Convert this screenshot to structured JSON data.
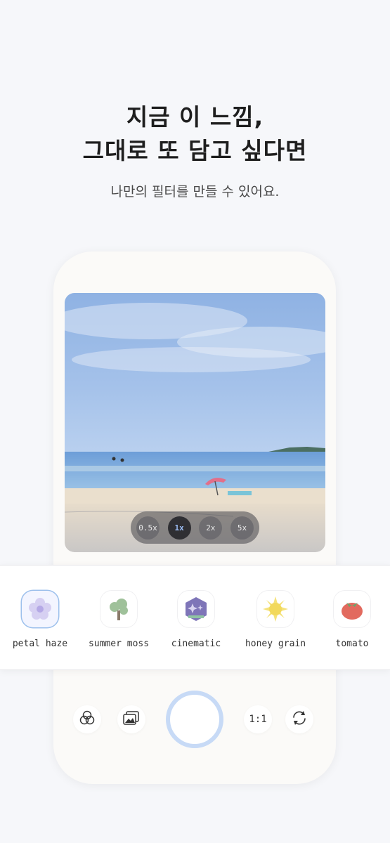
{
  "header": {
    "title_line1": "지금 이 느낌,",
    "title_line2": "그대로 또 담고 싶다면",
    "subtitle": "나만의 필터를 만들 수 있어요."
  },
  "camera": {
    "zoom_options": [
      "0.5x",
      "1x",
      "2x",
      "5x"
    ],
    "zoom_selected": "1x"
  },
  "filters": [
    {
      "label": "petal haze",
      "icon": "flower-icon",
      "selected": true
    },
    {
      "label": "summer moss",
      "icon": "tree-icon",
      "selected": false
    },
    {
      "label": "cinematic",
      "icon": "sparkle-hex-icon",
      "selected": false
    },
    {
      "label": "honey grain",
      "icon": "sun-icon",
      "selected": false
    },
    {
      "label": "tomato",
      "icon": "tomato-icon",
      "selected": false
    }
  ],
  "controls": {
    "ratio_label": "1:1",
    "shutter_color": "#c7daf6"
  },
  "colors": {
    "accent": "#9bbdf5",
    "background": "#f6f7fa"
  }
}
